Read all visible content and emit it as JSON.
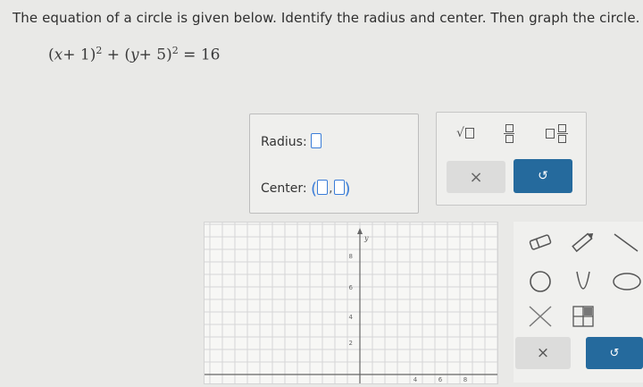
{
  "question": {
    "text": "The equation of a circle is given below. Identify the radius and center. Then graph the circle."
  },
  "equation": {
    "x_term": "x",
    "x_const": "+ 1",
    "y_term": "y",
    "y_const": "+ 5",
    "exponent": "2",
    "plus": "+",
    "equals": "=",
    "rhs": "16"
  },
  "answer": {
    "radius_label": "Radius:",
    "center_label": "Center:",
    "center_open": "(",
    "center_comma": ",",
    "center_close": ")"
  },
  "math_tools": {
    "sqrt_symbol": "√",
    "clear_symbol": "×",
    "undo_symbol": "↺"
  },
  "graph": {
    "y_axis_label": "y",
    "y_ticks": [
      "8",
      "6",
      "4",
      "2"
    ],
    "x_ticks": [
      "4",
      "6",
      "8"
    ]
  },
  "draw_tools": {
    "clear_symbol": "×",
    "undo_symbol": "↺"
  },
  "colors": {
    "accent": "#3b7dd8",
    "primary_button": "#256a9d",
    "background": "#e9e9e7"
  },
  "icons": [
    "eraser-icon",
    "pencil-icon",
    "line-icon",
    "circle-icon",
    "parabola-icon",
    "ellipse-icon",
    "no-solution-icon",
    "shade-icon",
    "clear-icon",
    "undo-icon"
  ]
}
